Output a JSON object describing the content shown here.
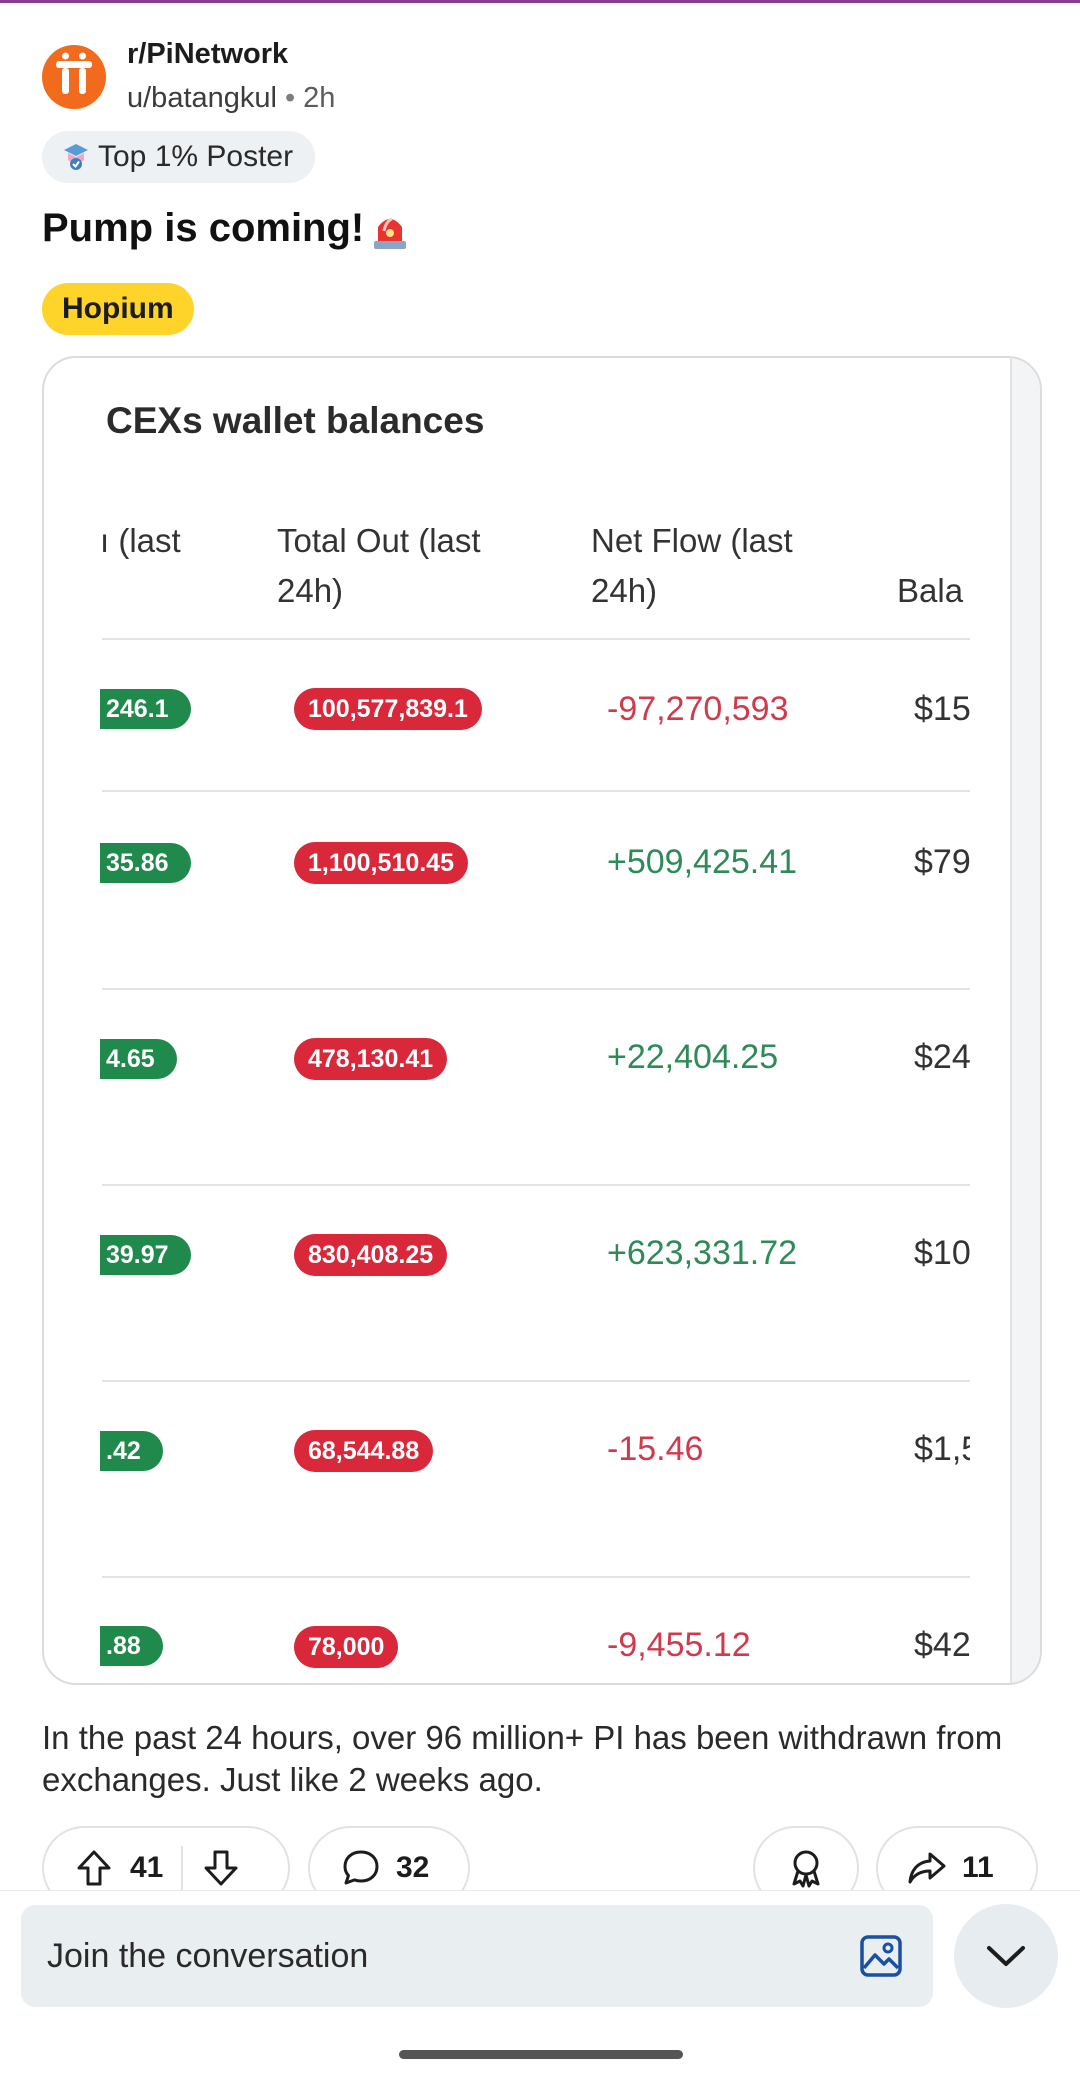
{
  "post": {
    "subreddit": "r/PiNetwork",
    "author": "u/batangkul",
    "separator": "•",
    "age": "2h",
    "badge": "Top 1% Poster",
    "title": "Pump is coming!",
    "flair": "Hopium",
    "body": "In the past 24 hours, over 96 million+ PI has been withdrawn from exchanges. Just like 2 weeks ago."
  },
  "image": {
    "title": "CEXs wallet balances",
    "headers": {
      "col1": "ı (last",
      "col2_line1": "Total Out (last",
      "col2_line2": "24h)",
      "col3_line1": "Net Flow (last",
      "col3_line2": "24h)",
      "col4": "Bala"
    },
    "rows": [
      {
        "in": "246.1",
        "out": "100,577,839.1",
        "net": "-97,270,593",
        "net_sign": "neg",
        "balance": "$15"
      },
      {
        "in": "35.86",
        "out": "1,100,510.45",
        "net": "+509,425.41",
        "net_sign": "pos",
        "balance": "$79"
      },
      {
        "in": "4.65",
        "out": "478,130.41",
        "net": "+22,404.25",
        "net_sign": "pos",
        "balance": "$24"
      },
      {
        "in": "39.97",
        "out": "830,408.25",
        "net": "+623,331.72",
        "net_sign": "pos",
        "balance": "$10"
      },
      {
        "in": ".42",
        "out": "68,544.88",
        "net": "-15.46",
        "net_sign": "neg",
        "balance": "$1,5"
      },
      {
        "in": ".88",
        "out": "78,000",
        "net": "-9,455.12",
        "net_sign": "neg",
        "balance": "$42"
      }
    ]
  },
  "actions": {
    "upvotes": "41",
    "comments": "32",
    "shares": "11"
  },
  "composer": {
    "placeholder": "Join the conversation"
  },
  "colors": {
    "brand": "#f26b1d",
    "flair": "#ffd42a",
    "green_pill": "#1f8a4c",
    "red_pill": "#d8283a",
    "negative": "#cf3b4c",
    "positive": "#2e8a58"
  }
}
